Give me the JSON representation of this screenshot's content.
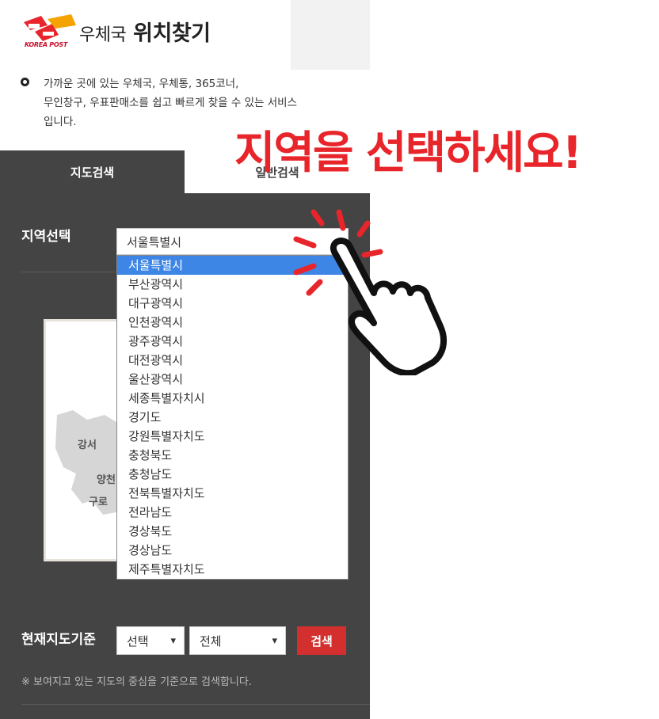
{
  "header": {
    "logo_text": "KOREA POST",
    "title_light": "우체국",
    "title_bold": "위치찾기",
    "description": "가까운 곳에 있는 우체국, 우체통, 365코너,\n무인창구, 우표판매소를 쉽고 빠르게 찾을 수 있는 서비스\n입니다."
  },
  "tabs": [
    {
      "label": "지도검색",
      "active": true
    },
    {
      "label": "일반검색",
      "active": false
    }
  ],
  "region": {
    "label": "지역선택",
    "selected": "서울특별시",
    "options": [
      "서울특별시",
      "부산광역시",
      "대구광역시",
      "인천광역시",
      "광주광역시",
      "대전광역시",
      "울산광역시",
      "세종특별자치시",
      "경기도",
      "강원특별자치도",
      "충청북도",
      "충청남도",
      "전북특별자치도",
      "전라남도",
      "경상북도",
      "경상남도",
      "제주특별자치도"
    ]
  },
  "map": {
    "labels": [
      "강서",
      "양천",
      "구로"
    ]
  },
  "current_map": {
    "label": "현재지도기준",
    "type_value": "선택",
    "scope_value": "전체",
    "search_label": "검색"
  },
  "note": "※ 보여지고 있는 지도의 중심을 기준으로 검색합니다.",
  "overlay": {
    "instruction": "지역을 선택하세요!"
  },
  "colors": {
    "panel": "#444444",
    "accent_red": "#d32f2f",
    "overlay_red": "#e8252a",
    "selected_blue": "#3e86e6"
  }
}
